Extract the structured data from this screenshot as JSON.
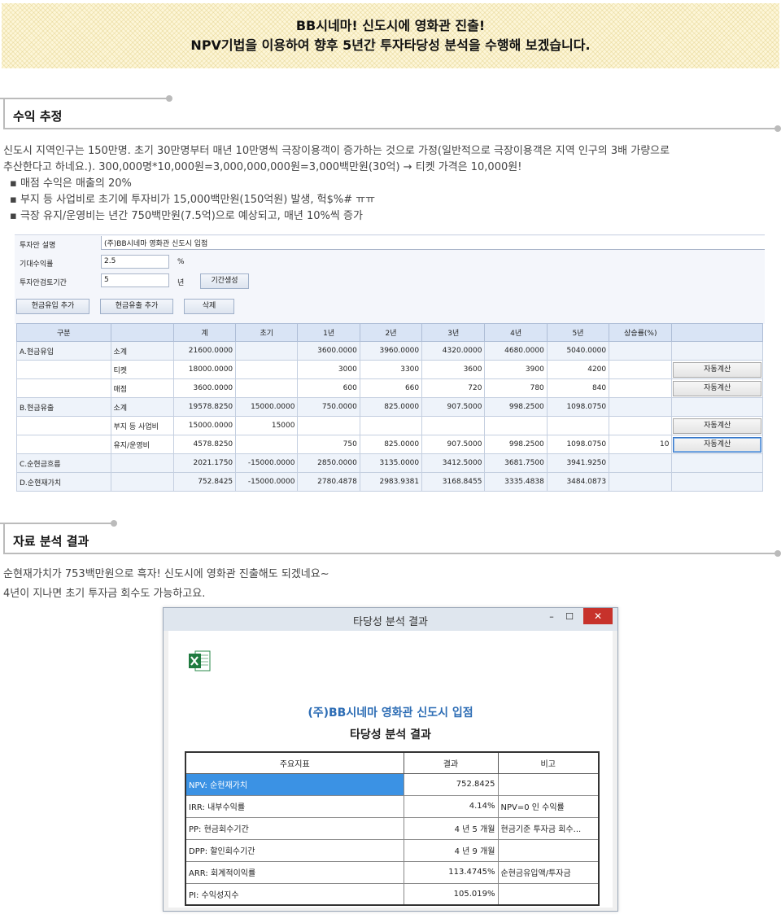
{
  "banner": {
    "line1": "BB시네마! 신도시에 영화관 진출!",
    "line2": "NPV기법을 이용하여 향후 5년간 투자타당성 분석을 수행해 보겠습니다."
  },
  "section1": {
    "title": "수익 추정",
    "para1": "신도시 지역인구는 150만명. 초기 30만명부터 매년 10만명씩 극장이용객이 증가하는 것으로 가정(일반적으로 극장이용객은 지역 인구의 3배 가량으로",
    "para2": "추산한다고 하네요.). 300,000명*10,000원=3,000,000,000원=3,000백만원(30억)  → 티켓 가격은 10,000원!",
    "bullets": [
      "▪ 매점 수익은 매출의 20%",
      "▪ 부지 등 사업비로 초기에 투자비가 15,000백만원(150억원)  발생, 헉$%# ㅠㅠ",
      "▪ 극장 유지/운영비는 년간 750백만원(7.5억)으로  예상되고, 매년 10%씩 증가"
    ]
  },
  "form": {
    "desc_label": "투자안 설명",
    "desc_value": "(주)BB시네마 영화관 신도시 입점",
    "rate_label": "기대수익률",
    "rate_value": "2.5",
    "rate_unit": "%",
    "period_label": "투자안검토기간",
    "period_value": "5",
    "period_unit": "년",
    "period_button": "기간생성",
    "add_inflow": "현금유입 추가",
    "add_outflow": "현금유출 추가",
    "delete": "삭제"
  },
  "grid": {
    "headers": [
      "구분",
      "",
      "계",
      "초기",
      "1년",
      "2년",
      "3년",
      "4년",
      "5년",
      "상승률(%)",
      ""
    ],
    "auto_label": "자동계산",
    "rows": [
      {
        "cat": "A.현금유입",
        "sub": "소계",
        "total": "21600.0000",
        "init": "",
        "y1": "3600.0000",
        "y2": "3960.0000",
        "y3": "4320.0000",
        "y4": "4680.0000",
        "y5": "5040.0000",
        "rate": "",
        "btn": false,
        "sum": true
      },
      {
        "cat": "",
        "sub": "티켓",
        "total": "18000.0000",
        "init": "",
        "y1": "3000",
        "y2": "3300",
        "y3": "3600",
        "y4": "3900",
        "y5": "4200",
        "rate": "",
        "btn": true,
        "sum": false
      },
      {
        "cat": "",
        "sub": "매점",
        "total": "3600.0000",
        "init": "",
        "y1": "600",
        "y2": "660",
        "y3": "720",
        "y4": "780",
        "y5": "840",
        "rate": "",
        "btn": true,
        "sum": false
      },
      {
        "cat": "B.현금유출",
        "sub": "소계",
        "total": "19578.8250",
        "init": "15000.0000",
        "y1": "750.0000",
        "y2": "825.0000",
        "y3": "907.5000",
        "y4": "998.2500",
        "y5": "1098.0750",
        "rate": "",
        "btn": false,
        "sum": true
      },
      {
        "cat": "",
        "sub": "부지 등 사업비",
        "total": "15000.0000",
        "init": "15000",
        "y1": "",
        "y2": "",
        "y3": "",
        "y4": "",
        "y5": "",
        "rate": "",
        "btn": true,
        "sum": false
      },
      {
        "cat": "",
        "sub": "유지/운영비",
        "total": "4578.8250",
        "init": "",
        "y1": "750",
        "y2": "825.0000",
        "y3": "907.5000",
        "y4": "998.2500",
        "y5": "1098.0750",
        "rate": "10",
        "btn": true,
        "focus": true,
        "sum": false
      },
      {
        "cat": "C.순현금흐름",
        "sub": "",
        "total": "2021.1750",
        "init": "-15000.0000",
        "y1": "2850.0000",
        "y2": "3135.0000",
        "y3": "3412.5000",
        "y4": "3681.7500",
        "y5": "3941.9250",
        "rate": "",
        "btn": false,
        "sum": true
      },
      {
        "cat": "D.순현재가치",
        "sub": "",
        "total": "752.8425",
        "init": "-15000.0000",
        "y1": "2780.4878",
        "y2": "2983.9381",
        "y3": "3168.8455",
        "y4": "3335.4838",
        "y5": "3484.0873",
        "rate": "",
        "btn": false,
        "sum": true
      }
    ]
  },
  "section2": {
    "title": "자료 분석 결과",
    "para1": "순현재가치가 753백만원으로 흑자! 신도시에 영화관 진출해도 되겠네요~",
    "para2": "4년이 지나면 초기 투자금 회수도 가능하고요."
  },
  "dialog": {
    "window_title": "타당성 분석 결과",
    "minimize": "–",
    "maximize": "☐",
    "close": "✕",
    "project_title": "(주)BB시네마 영화관 신도시 입점",
    "result_title": "타당성 분석 결과",
    "headers": [
      "주요지표",
      "결과",
      "비고"
    ],
    "rows": [
      {
        "metric": "NPV: 순현재가치",
        "result": "752.8425",
        "note": ""
      },
      {
        "metric": "IRR: 내부수익률",
        "result": "4.14%",
        "note": "NPV=0 인 수익률"
      },
      {
        "metric": "PP: 현금회수기간",
        "result": "4 년 5 개월",
        "note": "현금기준 투자금 회수..."
      },
      {
        "metric": "DPP: 할인회수기간",
        "result": "4 년 9 개월",
        "note": ""
      },
      {
        "metric": "ARR: 회계적이익률",
        "result": "113.4745%",
        "note": "순현금유입액/투자금"
      },
      {
        "metric": "PI: 수익성지수",
        "result": "105.019%",
        "note": ""
      }
    ],
    "colors": {
      "selected": "#3b92e4",
      "title_blue": "#2d6db5",
      "close_red": "#c7322b"
    }
  }
}
